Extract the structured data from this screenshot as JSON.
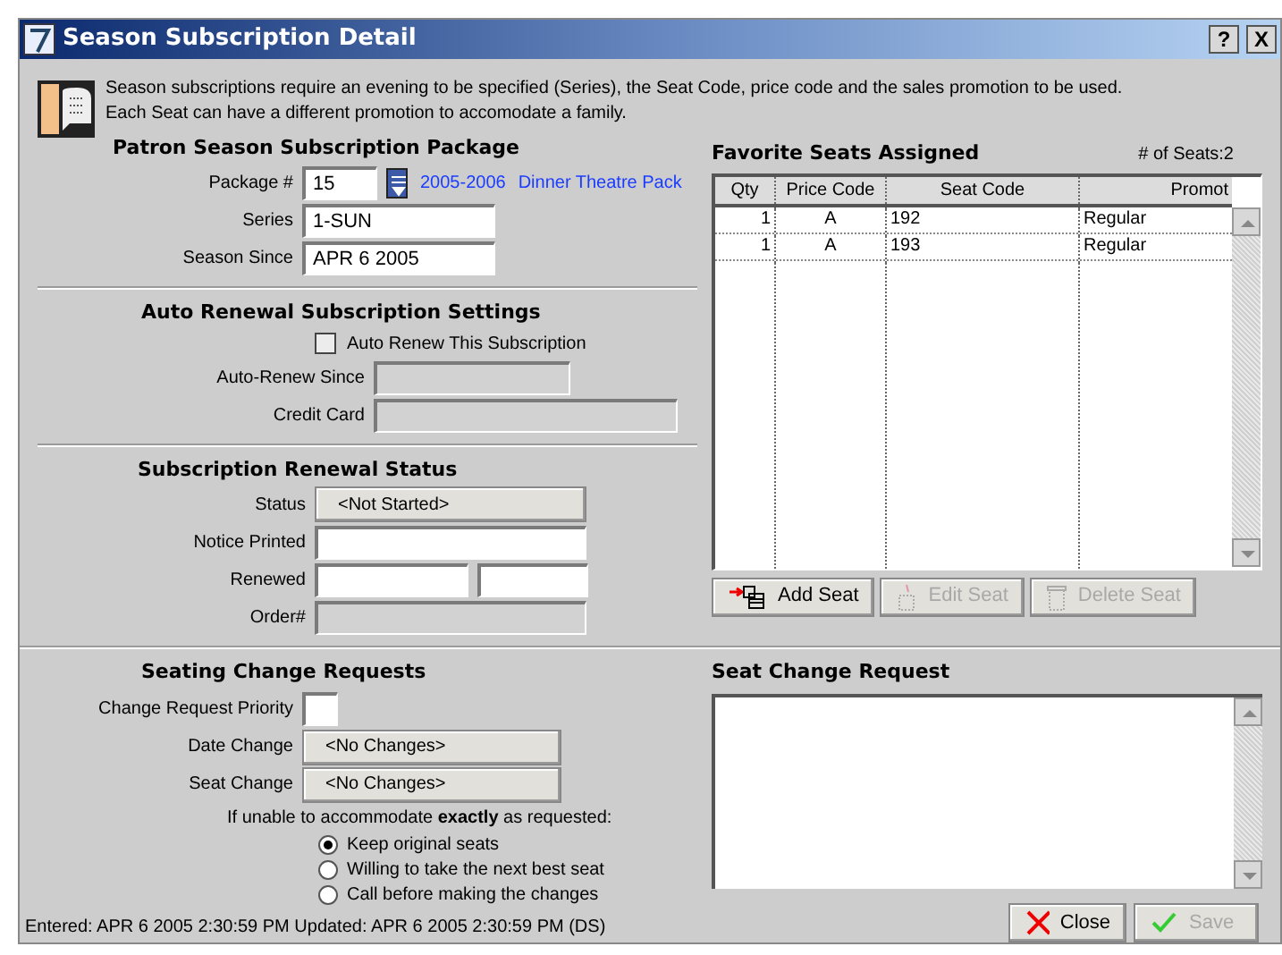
{
  "window": {
    "title": "Season Subscription Detail",
    "title_buttons": [
      "?",
      "X"
    ]
  },
  "intro": "Season subscriptions require an evening to be specified (Series), the Seat Code, price code and the sales promotion to be used. Each Seat can have a different promotion to accomodate a family.",
  "package_section": {
    "heading": "Patron Season Subscription Package",
    "package": {
      "label": "Package #",
      "value": "15",
      "links": [
        "2005-2006",
        "Dinner Theatre Pack"
      ]
    },
    "fields": [
      {
        "label": "Series",
        "value": "1-SUN"
      },
      {
        "label": "Season Since",
        "value": "APR 6 2005"
      }
    ]
  },
  "auto_renewal": {
    "heading": "Auto Renewal Subscription Settings",
    "checkbox": {
      "label": "Auto Renew This Subscription",
      "checked": false
    },
    "fields": [
      {
        "label": "Auto-Renew Since",
        "kind": "input",
        "disabled": true
      },
      {
        "label": "Credit Card",
        "kind": "input",
        "disabled": true
      }
    ]
  },
  "renewal_status": {
    "heading": "Subscription Renewal Status",
    "fields": [
      {
        "label": "Status",
        "kind": "select",
        "value": "<Not Started>"
      },
      {
        "label": "Notice Printed",
        "kind": "input",
        "disabled": false
      },
      {
        "label": "Renewed",
        "kind": "pair",
        "disabled": false
      },
      {
        "label": "Order#",
        "kind": "input",
        "disabled": true
      }
    ]
  },
  "seating_changes": {
    "heading": "Seating Change Requests",
    "fields": [
      {
        "label": "Change Request Priority",
        "kind": "small",
        "disabled": false
      },
      {
        "label": "Date Change",
        "kind": "select",
        "value": "<No Changes>"
      },
      {
        "label": "Seat Change",
        "kind": "select",
        "value": "<No Changes>"
      }
    ],
    "prompt": "If unable to accommodate **exactly** as requested:",
    "options": [
      {
        "label": "Keep original seats",
        "selected": true
      },
      {
        "label": "Willing to take the next best seat",
        "selected": false
      },
      {
        "label": "Call before making the changes",
        "selected": false
      }
    ]
  },
  "status_line": "Entered: APR 6 2005 2:30:59 PM  Updated: APR 6 2005 2:30:59 PM (DS)",
  "favorite_seats": {
    "heading": "Favorite Seats Assigned",
    "count": "# of Seats:2",
    "table": {
      "columns": [
        "Qty",
        "Price Code",
        "Seat Code",
        "Promot"
      ],
      "rows": [
        [
          "1",
          "A",
          "192",
          "Regular"
        ],
        [
          "1",
          "A",
          "193",
          "Regular"
        ]
      ]
    },
    "buttons": [
      {
        "kind": "add",
        "label": "Add Seat",
        "disabled": false
      },
      {
        "kind": "edit",
        "label": "Edit Seat",
        "disabled": true
      },
      {
        "kind": "delete",
        "label": "Delete Seat",
        "disabled": true
      }
    ]
  },
  "seat_change_request": {
    "heading": "Seat Change Request"
  },
  "dialog_buttons": [
    {
      "kind": "close",
      "label": "Close",
      "disabled": false
    },
    {
      "kind": "save",
      "label": "Save",
      "disabled": true
    }
  ]
}
